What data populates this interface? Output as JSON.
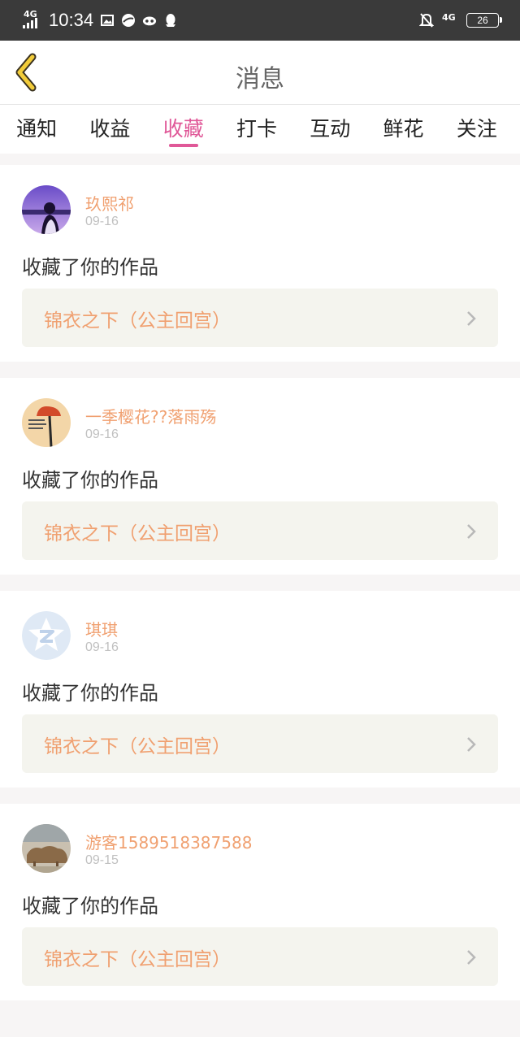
{
  "status_bar": {
    "network_left": "4G",
    "time": "10:34",
    "network_right": "4G",
    "battery": "26"
  },
  "header": {
    "title": "消息"
  },
  "tabs": [
    {
      "label": "通知",
      "active": false
    },
    {
      "label": "收益",
      "active": false
    },
    {
      "label": "收藏",
      "active": true
    },
    {
      "label": "打卡",
      "active": false
    },
    {
      "label": "互动",
      "active": false
    },
    {
      "label": "鲜花",
      "active": false
    },
    {
      "label": "关注",
      "active": false
    }
  ],
  "colors": {
    "accent": "#e05898",
    "name": "#f0a070",
    "work_bg": "#f4f4ee"
  },
  "feed": [
    {
      "user": "玖熙祁",
      "date": "09-16",
      "action": "收藏了你的作品",
      "work": "锦衣之下（公主回宫）"
    },
    {
      "user": "一季樱花??落雨殇",
      "date": "09-16",
      "action": "收藏了你的作品",
      "work": "锦衣之下（公主回宫）"
    },
    {
      "user": "琪琪",
      "date": "09-16",
      "action": "收藏了你的作品",
      "work": "锦衣之下（公主回宫）"
    },
    {
      "user": "游客1589518387588",
      "date": "09-15",
      "action": "收藏了你的作品",
      "work": "锦衣之下（公主回宫）"
    }
  ]
}
